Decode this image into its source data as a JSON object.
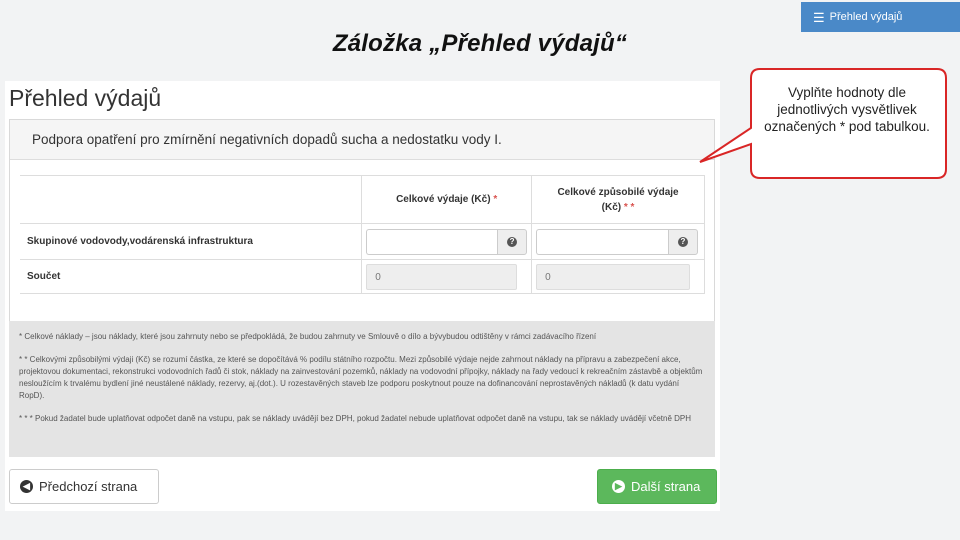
{
  "slide": {
    "title": "Záložka „Přehled výdajů“",
    "top_tab_label": "Přehled výdajů"
  },
  "callout": {
    "text": "Vyplňte hodnoty dle jednotlivých vysvětlivek označených * pod tabulkou."
  },
  "page": {
    "heading": "Přehled výdajů",
    "panel_title": "Podpora opatření pro zmírnění negativních dopadů sucha a nedostatku vody I."
  },
  "table": {
    "col1_header": "Celkové výdaje (Kč)",
    "col1_marker": "*",
    "col2_header": "Celkové způsobilé výdaje (Kč)",
    "col2_marker": "* *",
    "row1_label": "Skupinové vodovody,vodárenská infrastruktura",
    "row2_label": "Součet",
    "sum_total": "0",
    "sum_eligible": "0"
  },
  "notes": {
    "note1": "* Celkové náklady – jsou náklady, které jsou zahrnuty nebo se předpokládá, že budou zahrnuty ve Smlouvě o dílo a bývybudou odtištěny v rámci zadávacího řízení",
    "note2": "* * Celkovými způsobilými výdaji (Kč) se rozumí částka, ze které se dopočítává % podílu státního rozpočtu. Mezi způsobilé výdaje nejde zahrnout náklady na přípravu a zabezpečení akce, projektovou dokumentaci, rekonstrukci vodovodních řadů či stok, náklady na zainvestování pozemků, náklady na vodovodní přípojky, náklady na řady vedoucí k rekreačním zástavbě a objektům nesloužícím k trvalému bydlení jiné neustálené náklady, rezervy, aj.(dot.). U rozestavěných staveb lze podporu poskytnout pouze na dofinancování neprostavěných nákladů (k datu vydání RopD).",
    "note3": "* * * Pokud žadatel bude uplatňovat odpočet daně na vstupu, pak se náklady uvádějí bez DPH, pokud žadatel nebude uplatňovat odpočet daně na vstupu, tak se náklady uvádějí včetně DPH"
  },
  "buttons": {
    "prev_label": "Předchozí strana",
    "next_label": "Další strana"
  }
}
